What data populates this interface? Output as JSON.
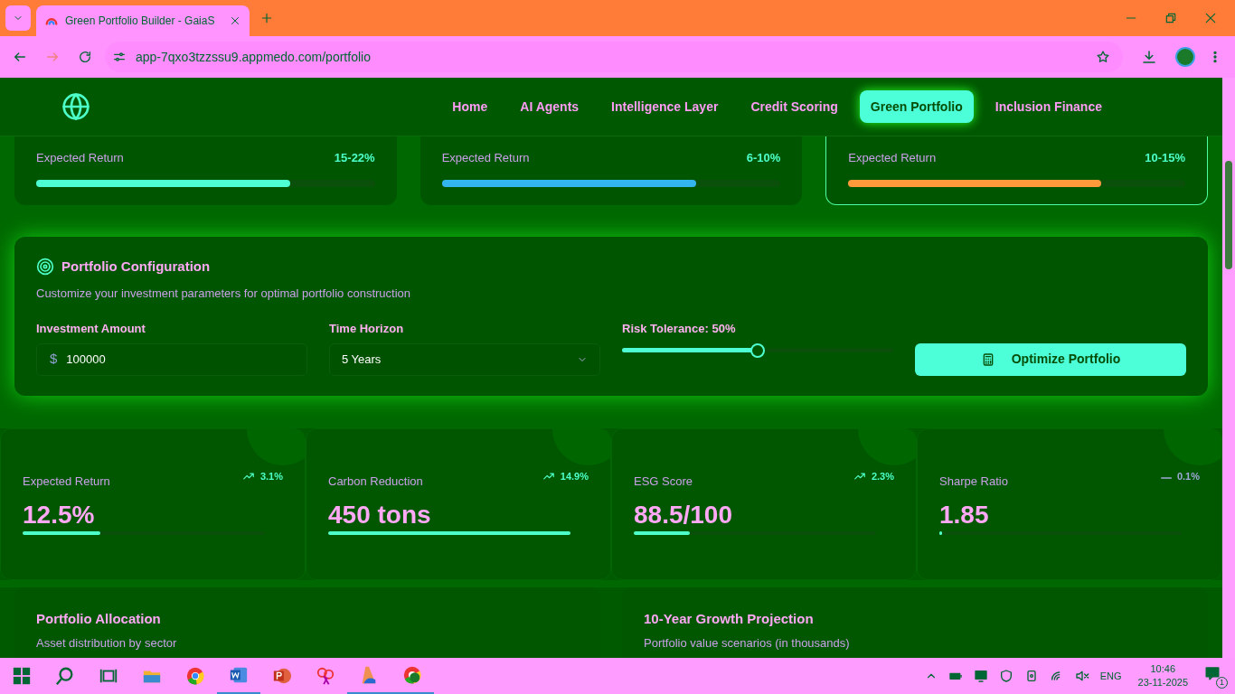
{
  "browser": {
    "tab_title": "Green Portfolio Builder - GaiaS",
    "url": "app-7qxo3tzzssu9.appmedo.com/portfolio"
  },
  "nav": [
    {
      "label": "Home",
      "selected": false
    },
    {
      "label": "AI Agents",
      "selected": false
    },
    {
      "label": "Intelligence Layer",
      "selected": false
    },
    {
      "label": "Credit Scoring",
      "selected": false
    },
    {
      "label": "Green Portfolio",
      "selected": true
    },
    {
      "label": "Inclusion Finance",
      "selected": false
    }
  ],
  "strategies": [
    {
      "label": "Expected Return",
      "value": "15-22%",
      "level": 0.75,
      "color": "#4dffd2",
      "selected": false
    },
    {
      "label": "Expected Return",
      "value": "6-10%",
      "level": 0.75,
      "color": "#33b5f0",
      "selected": false
    },
    {
      "label": "Expected Return",
      "value": "10-15%",
      "level": 0.75,
      "color": "#ff9a3c",
      "selected": true
    }
  ],
  "configuration": {
    "title": "Portfolio Configuration",
    "subtitle": "Customize your investment parameters for optimal portfolio construction",
    "amount": {
      "label": "Investment Amount",
      "currency": "$",
      "value": "100000"
    },
    "horizon": {
      "label": "Time Horizon",
      "value": "5 Years"
    },
    "risk": {
      "label": "Risk Tolerance: 50%",
      "level": 0.5
    },
    "button": "Optimize Portfolio"
  },
  "metrics": [
    {
      "label": "Expected Return",
      "change": "3.1%",
      "kind": "up",
      "value": "12.5%",
      "level": 0.32
    },
    {
      "label": "Carbon Reduction",
      "change": "14.9%",
      "kind": "up",
      "value": "450 tons",
      "level": 1.0
    },
    {
      "label": "ESG Score",
      "change": "2.3%",
      "kind": "up",
      "value": "88.5/100",
      "level": 0.23
    },
    {
      "label": "Sharpe Ratio",
      "change": "0.1%",
      "kind": "flat",
      "value": "1.85",
      "level": 0.01
    }
  ],
  "panels": [
    {
      "title": "Portfolio Allocation",
      "subtitle": "Asset distribution by sector"
    },
    {
      "title": "10-Year Growth Projection",
      "subtitle": "Portfolio value scenarios (in thousands)"
    }
  ],
  "taskbar": {
    "language": "ENG",
    "time": "10:46",
    "date": "23-11-2025",
    "notifications": "1"
  }
}
